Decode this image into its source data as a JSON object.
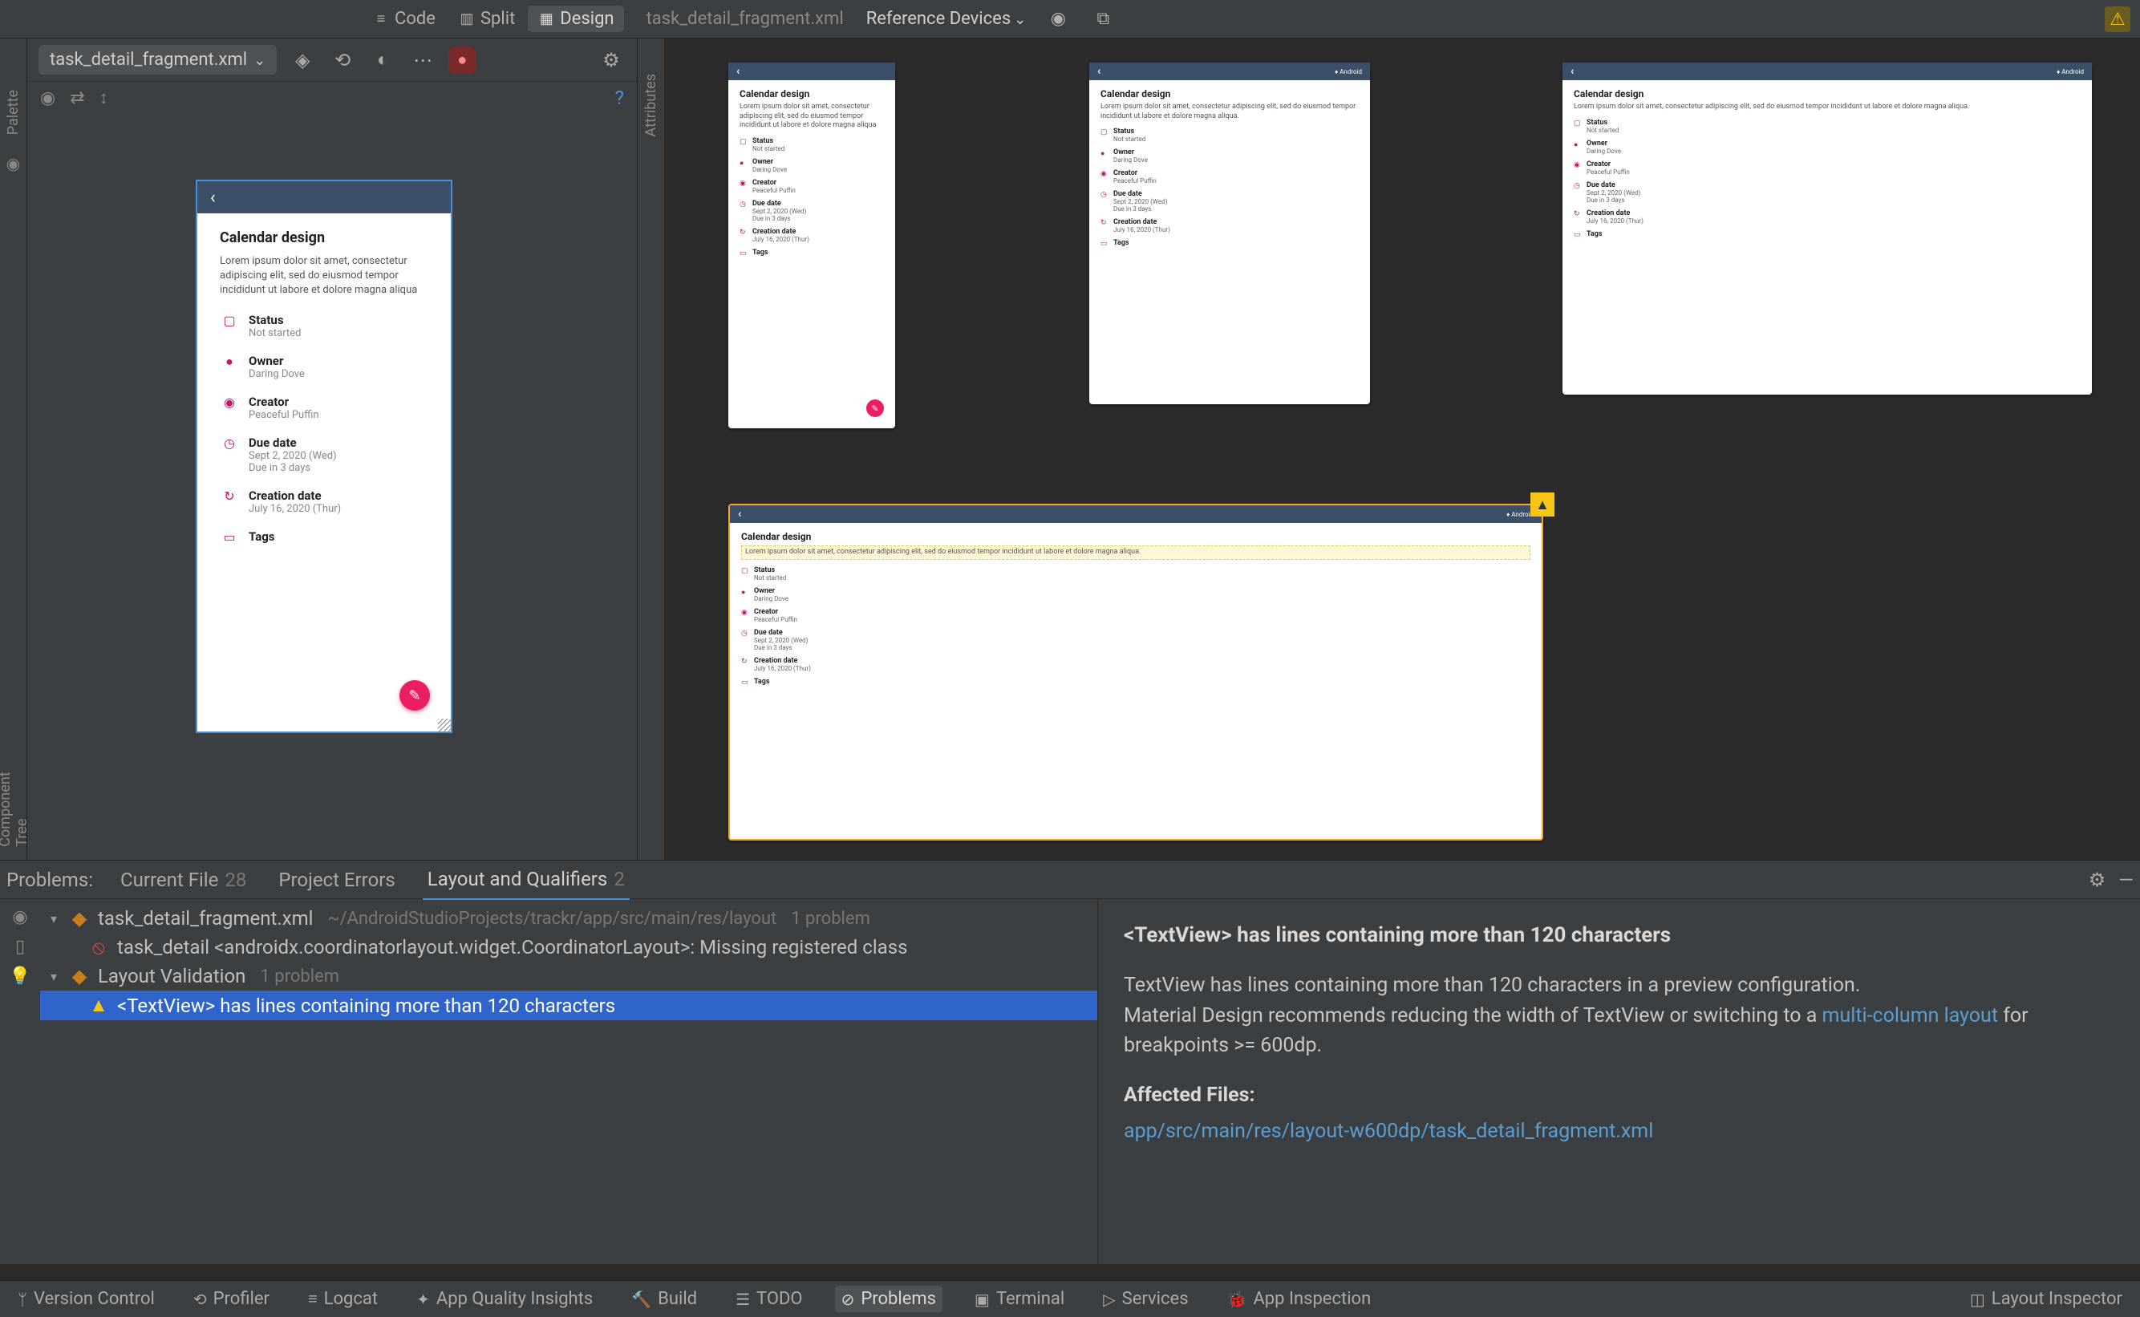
{
  "modes": {
    "code": "Code",
    "split": "Split",
    "design": "Design"
  },
  "file_tab": "task_detail_fragment.xml",
  "reference_devices": "Reference Devices",
  "palette": "Palette",
  "attributes": "Attributes",
  "component_tree": "Component Tree",
  "task": {
    "title": "Calendar design",
    "desc": "Lorem ipsum dolor sit amet, consectetur adipiscing elit, sed do eiusmod tempor incididunt ut labore et dolore magna aliqua",
    "desc_long": "Lorem ipsum dolor sit amet, consectetur adipiscing elit, sed do eiusmod tempor incididunt ut labore et dolore magna aliqua.",
    "fields": {
      "status": {
        "label": "Status",
        "value": "Not started"
      },
      "owner": {
        "label": "Owner",
        "value": "Daring Dove"
      },
      "creator": {
        "label": "Creator",
        "value": "Peaceful Puffin"
      },
      "due": {
        "label": "Due date",
        "value": "Sept 2, 2020 (Wed)",
        "extra": "Due in 3 days"
      },
      "created": {
        "label": "Creation date",
        "value": "July 16, 2020 (Thur)"
      },
      "tags": {
        "label": "Tags",
        "value": ""
      }
    }
  },
  "android_label": "Android",
  "problems": {
    "label": "Problems:",
    "tabs": {
      "current": {
        "label": "Current File",
        "count": "28"
      },
      "project": {
        "label": "Project Errors",
        "count": ""
      },
      "layout": {
        "label": "Layout and Qualifiers",
        "count": "2"
      }
    },
    "tree": {
      "file_name": "task_detail_fragment.xml",
      "file_path": "~/AndroidStudioProjects/trackr/app/src/main/res/layout",
      "file_count": "1 problem",
      "error_row": "task_detail <androidx.coordinatorlayout.widget.CoordinatorLayout>: Missing registered class",
      "group_label": "Layout Validation",
      "group_count": "1 problem",
      "warning_row": "<TextView> has lines containing more than 120 characters"
    },
    "detail": {
      "title": "<TextView> has lines containing more than 120 characters",
      "body1": "TextView has lines containing more than 120 characters in a preview configuration.",
      "body2a": "Material Design recommends reducing the width of TextView or switching to a ",
      "body2_link": "multi-column layout",
      "body2b": " for breakpoints >= 600dp.",
      "affected_label": "Affected Files:",
      "affected_link": "app/src/main/res/layout-w600dp/task_detail_fragment.xml"
    }
  },
  "bottom": {
    "version": "Version Control",
    "profiler": "Profiler",
    "logcat": "Logcat",
    "quality": "App Quality Insights",
    "build": "Build",
    "todo": "TODO",
    "problems": "Problems",
    "terminal": "Terminal",
    "services": "Services",
    "inspection": "App Inspection",
    "layout_inspector": "Layout Inspector"
  }
}
